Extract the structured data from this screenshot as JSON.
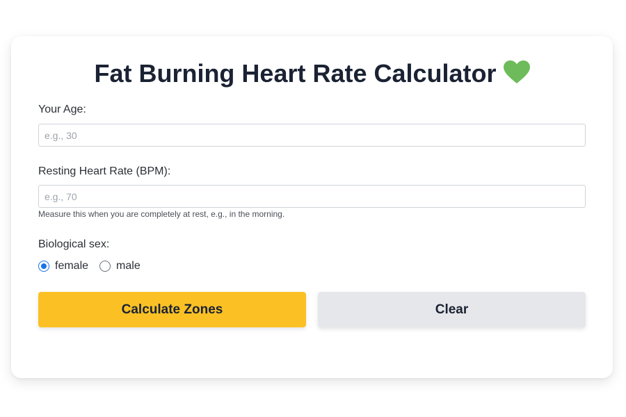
{
  "title": {
    "text": "Fat Burning Heart Rate Calculator",
    "icon": "green-heart-icon",
    "icon_color": "#6dbb5a"
  },
  "form": {
    "age": {
      "label": "Your Age:",
      "placeholder": "e.g., 30",
      "value": ""
    },
    "resting_hr": {
      "label": "Resting Heart Rate (BPM):",
      "placeholder": "e.g., 70",
      "value": "",
      "hint": "Measure this when you are completely at rest, e.g., in the morning."
    },
    "sex": {
      "label": "Biological sex:",
      "options": [
        {
          "label": "female",
          "checked": true
        },
        {
          "label": "male",
          "checked": false
        }
      ]
    }
  },
  "buttons": {
    "calculate_label": "Calculate Zones",
    "clear_label": "Clear"
  },
  "colors": {
    "accent_button": "#fbc124",
    "secondary_button": "#e6e7ea",
    "radio_selected": "#1a73e8"
  }
}
